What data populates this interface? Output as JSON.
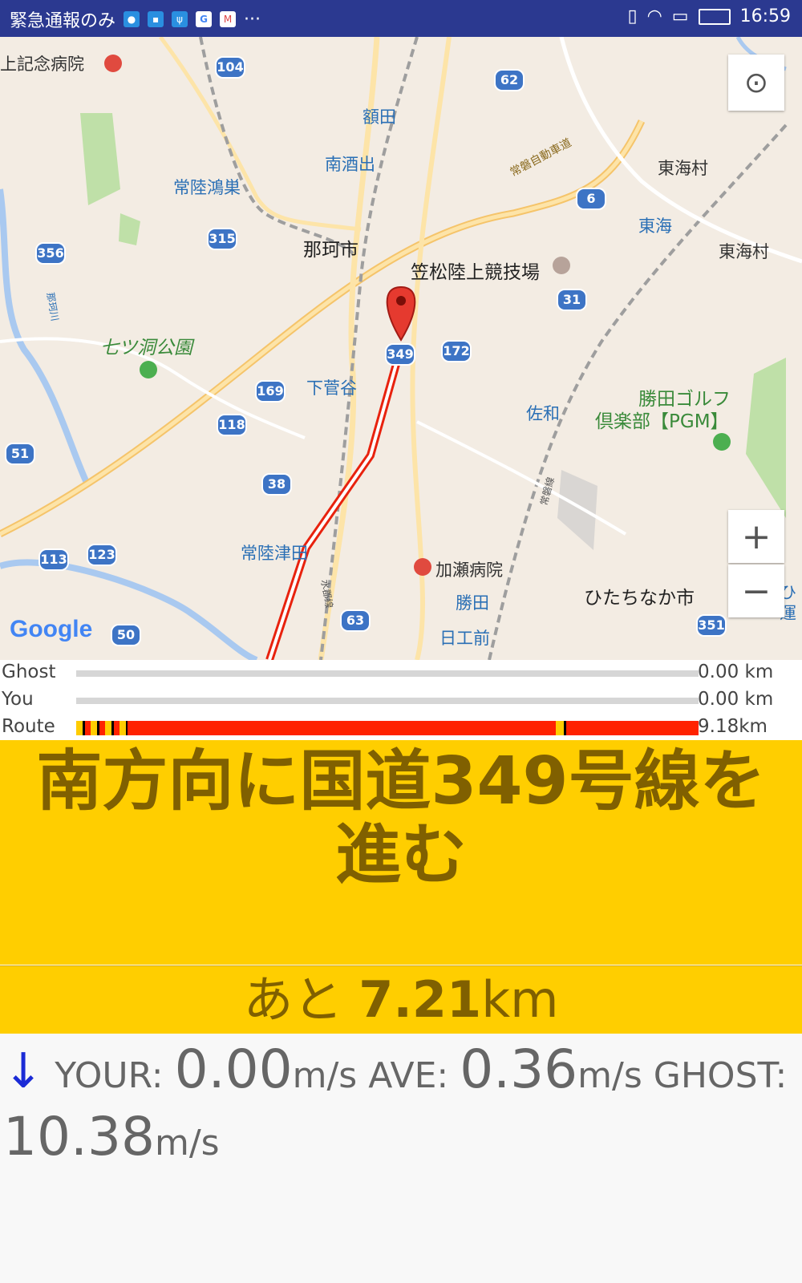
{
  "status_bar": {
    "left_text": "緊急通報のみ",
    "more": "···",
    "time": "16:59",
    "colors": {
      "background": "#2b3990"
    }
  },
  "map": {
    "labels": {
      "hospital_top": "上記念病院",
      "nukata": "額田",
      "minamisakade": "南酒出",
      "hitachi_kounosu": "常陸鴻巣",
      "nakashi": "那珂市",
      "kasamatsu": "笠松陸上競技場",
      "tokaimura1": "東海村",
      "tokai": "東海",
      "tokaimura2": "東海村",
      "joban_expressway": "常磐自動車道",
      "nanatsudo": "七ツ洞公園",
      "shimosugaya": "下菅谷",
      "sawa": "佐和",
      "katsuta_golf_1": "勝田ゴルフ",
      "katsuta_golf_2": "倶楽部【PGM】",
      "hitachi_tsuda": "常陸津田",
      "kase_hospital": "加瀬病院",
      "katsuta": "勝田",
      "hitachinaka": "ひたちなか市",
      "nikkomae": "日工前",
      "suigun_line": "水郡線",
      "joban_line": "常磐線",
      "naka_river": "那珂川",
      "edge": "ひ運"
    },
    "shields": [
      "104",
      "62",
      "6",
      "356",
      "315",
      "31",
      "349",
      "172",
      "169",
      "118",
      "51",
      "38",
      "113",
      "123",
      "63",
      "50",
      "351"
    ],
    "google": "Google",
    "zoom_in": "+",
    "zoom_out": "−"
  },
  "progress": {
    "ghost_label": "Ghost",
    "ghost_value": "0.00 km",
    "ghost_fraction": 0,
    "you_label": "You",
    "you_value": "0.00 km",
    "you_fraction": 0,
    "route_label": "Route",
    "route_value": "9.18km",
    "colors": {
      "route": "#ff2200",
      "track": "#d6d6d6",
      "marker": "#ffcc00"
    }
  },
  "instruction": {
    "text": "南方向に国道349号線を進む",
    "colors": {
      "background": "#ffce00",
      "text": "#806000"
    }
  },
  "remaining": {
    "prefix": "あと",
    "value": "7.21",
    "unit": "km"
  },
  "speed": {
    "arrow": "↓",
    "your_label": "YOUR: ",
    "your_value": "0.00",
    "ave_label": "AVE: ",
    "ave_value": "0.36",
    "ghost_label": "GHOST: ",
    "ghost_value": "10.38",
    "unit": "m/s"
  }
}
